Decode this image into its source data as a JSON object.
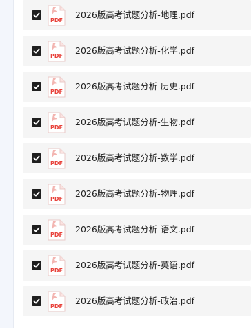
{
  "files": [
    {
      "name": "2026版高考试题分析-地理.pdf",
      "checked": true,
      "icon": "pdf-icon"
    },
    {
      "name": "2026版高考试题分析-化学.pdf",
      "checked": true,
      "icon": "pdf-icon"
    },
    {
      "name": "2026版高考试题分析-历史.pdf",
      "checked": true,
      "icon": "pdf-icon"
    },
    {
      "name": "2026版高考试题分析-生物.pdf",
      "checked": true,
      "icon": "pdf-icon"
    },
    {
      "name": "2026版高考试题分析-数学.pdf",
      "checked": true,
      "icon": "pdf-icon"
    },
    {
      "name": "2026版高考试题分析-物理.pdf",
      "checked": true,
      "icon": "pdf-icon"
    },
    {
      "name": "2026版高考试题分析-语文.pdf",
      "checked": true,
      "icon": "pdf-icon"
    },
    {
      "name": "2026版高考试题分析-英语.pdf",
      "checked": true,
      "icon": "pdf-icon"
    },
    {
      "name": "2026版高考试题分析-政治.pdf",
      "checked": true,
      "icon": "pdf-icon"
    }
  ],
  "pdf_icon_label": "PDF",
  "colors": {
    "row_background": "#f5f5f5",
    "checkbox": "#1f1f1f",
    "pdf_red": "#e8413a"
  }
}
